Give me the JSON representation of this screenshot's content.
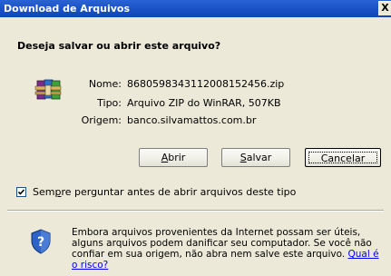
{
  "window": {
    "title": "Download de Arquivos",
    "close_label": "X"
  },
  "dialog": {
    "heading": "Deseja salvar ou abrir este arquivo?",
    "file_icon": "winrar-archive-icon",
    "fields": [
      {
        "label": "Nome:",
        "value": "8680598343112008152456.zip"
      },
      {
        "label": "Tipo:",
        "value": "Arquivo ZIP do WinRAR, 507KB"
      },
      {
        "label": "Origem:",
        "value": "banco.silvamattos.com.br"
      }
    ]
  },
  "buttons": {
    "open": {
      "mnemonic": "A",
      "rest": "brir"
    },
    "save": {
      "mnemonic": "S",
      "rest": "alvar"
    },
    "cancel": "Cancelar"
  },
  "checkbox": {
    "checked": true,
    "label_pre": "Sem",
    "label_mnemonic": "p",
    "label_post": "re perguntar antes de abrir arquivos deste tipo"
  },
  "warning": {
    "icon": "security-shield-icon",
    "text": "Embora arquivos provenientes da Internet possam ser úteis, alguns arquivos podem danificar seu computador. Se você não confiar em sua origem, não abra nem salve este arquivo.",
    "link": "Qual é o risco?"
  }
}
